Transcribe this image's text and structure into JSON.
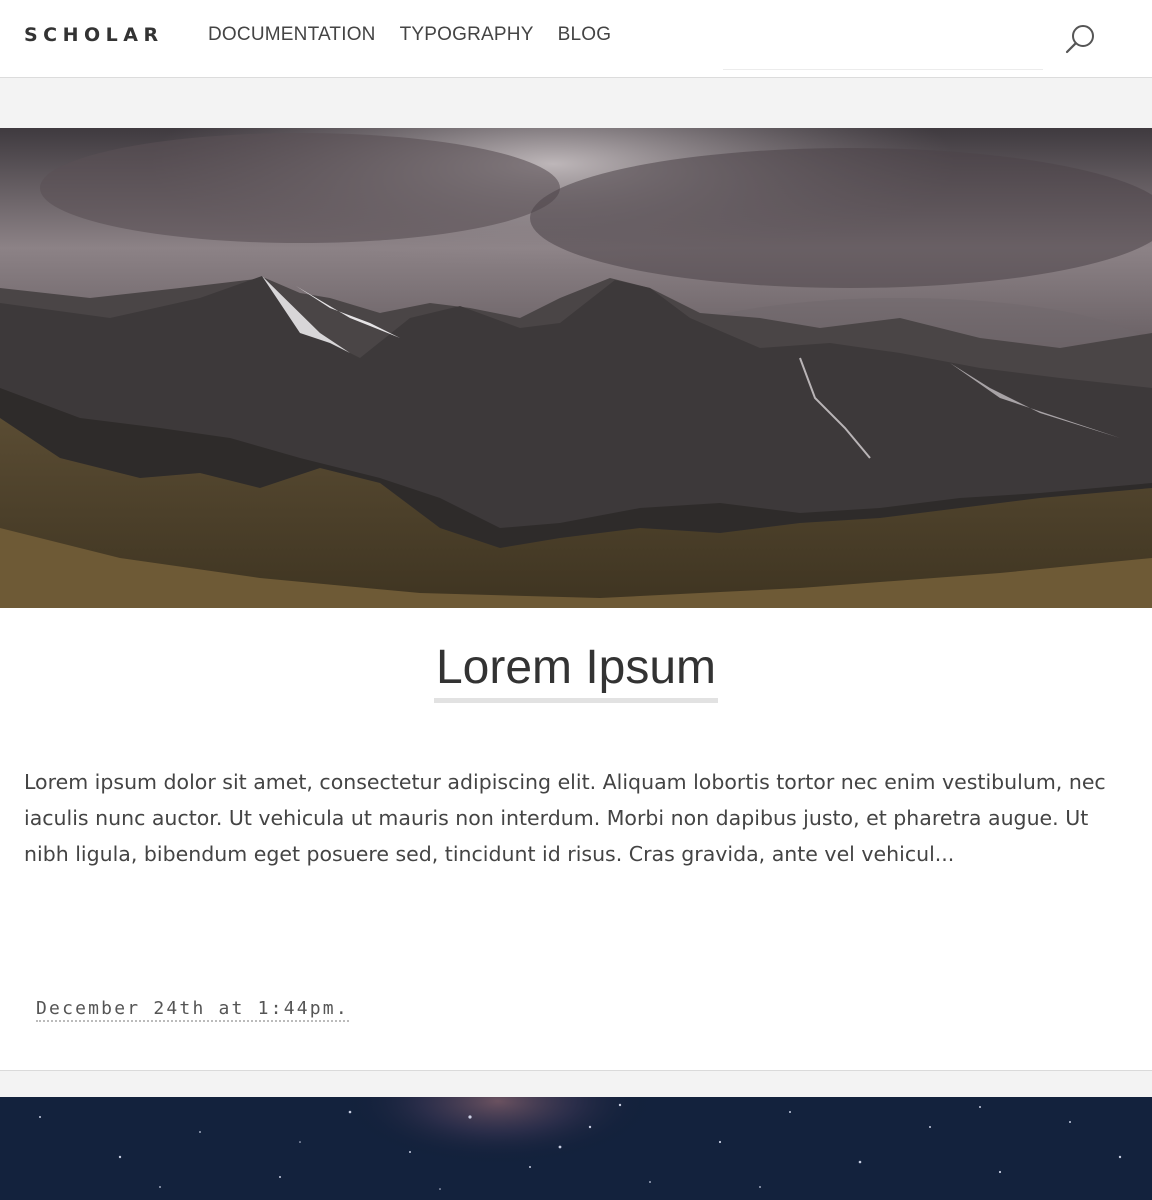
{
  "header": {
    "brand": "SCHOLAR",
    "nav": [
      "DOCUMENTATION",
      "TYPOGRAPHY",
      "BLOG"
    ],
    "search": {
      "value": "",
      "placeholder": ""
    },
    "search_icon": "search-icon"
  },
  "post": {
    "title": "Lorem Ipsum",
    "excerpt": "Lorem ipsum dolor sit amet, consectetur adipiscing elit. Aliquam lobortis tortor nec enim vestibulum, nec iaculis nunc auctor. Ut vehicula ut mauris non interdum. Morbi non dapibus justo, et pharetra augue. Ut nibh ligula, bibendum eget posuere sed, tincidunt id risus. Cras gravida, ante vel vehicul...",
    "date": "December 24th at 1:44pm.",
    "image": "mountain-landscape-image"
  },
  "next_post": {
    "image": "milky-way-night-sky-image"
  },
  "colors": {
    "accent_underline": "#e2e2e2",
    "text": "#333333",
    "page_bg": "#f3f3f3"
  }
}
